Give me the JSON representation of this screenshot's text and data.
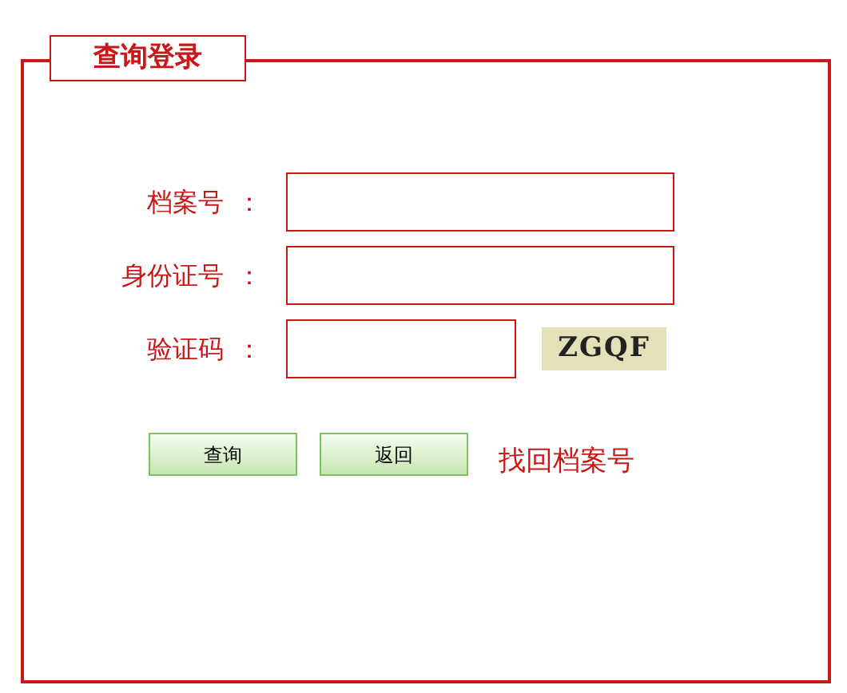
{
  "panel": {
    "title": "查询登录"
  },
  "fields": [
    {
      "kind": "text",
      "label": "档案号",
      "colon": "："
    },
    {
      "kind": "text",
      "label": "身份证号",
      "colon": "："
    },
    {
      "kind": "captcha",
      "label": "验证码",
      "colon": "：",
      "captcha": "ZGQF"
    }
  ],
  "buttons": [
    "查询",
    "返回"
  ],
  "link": "找回档案号"
}
